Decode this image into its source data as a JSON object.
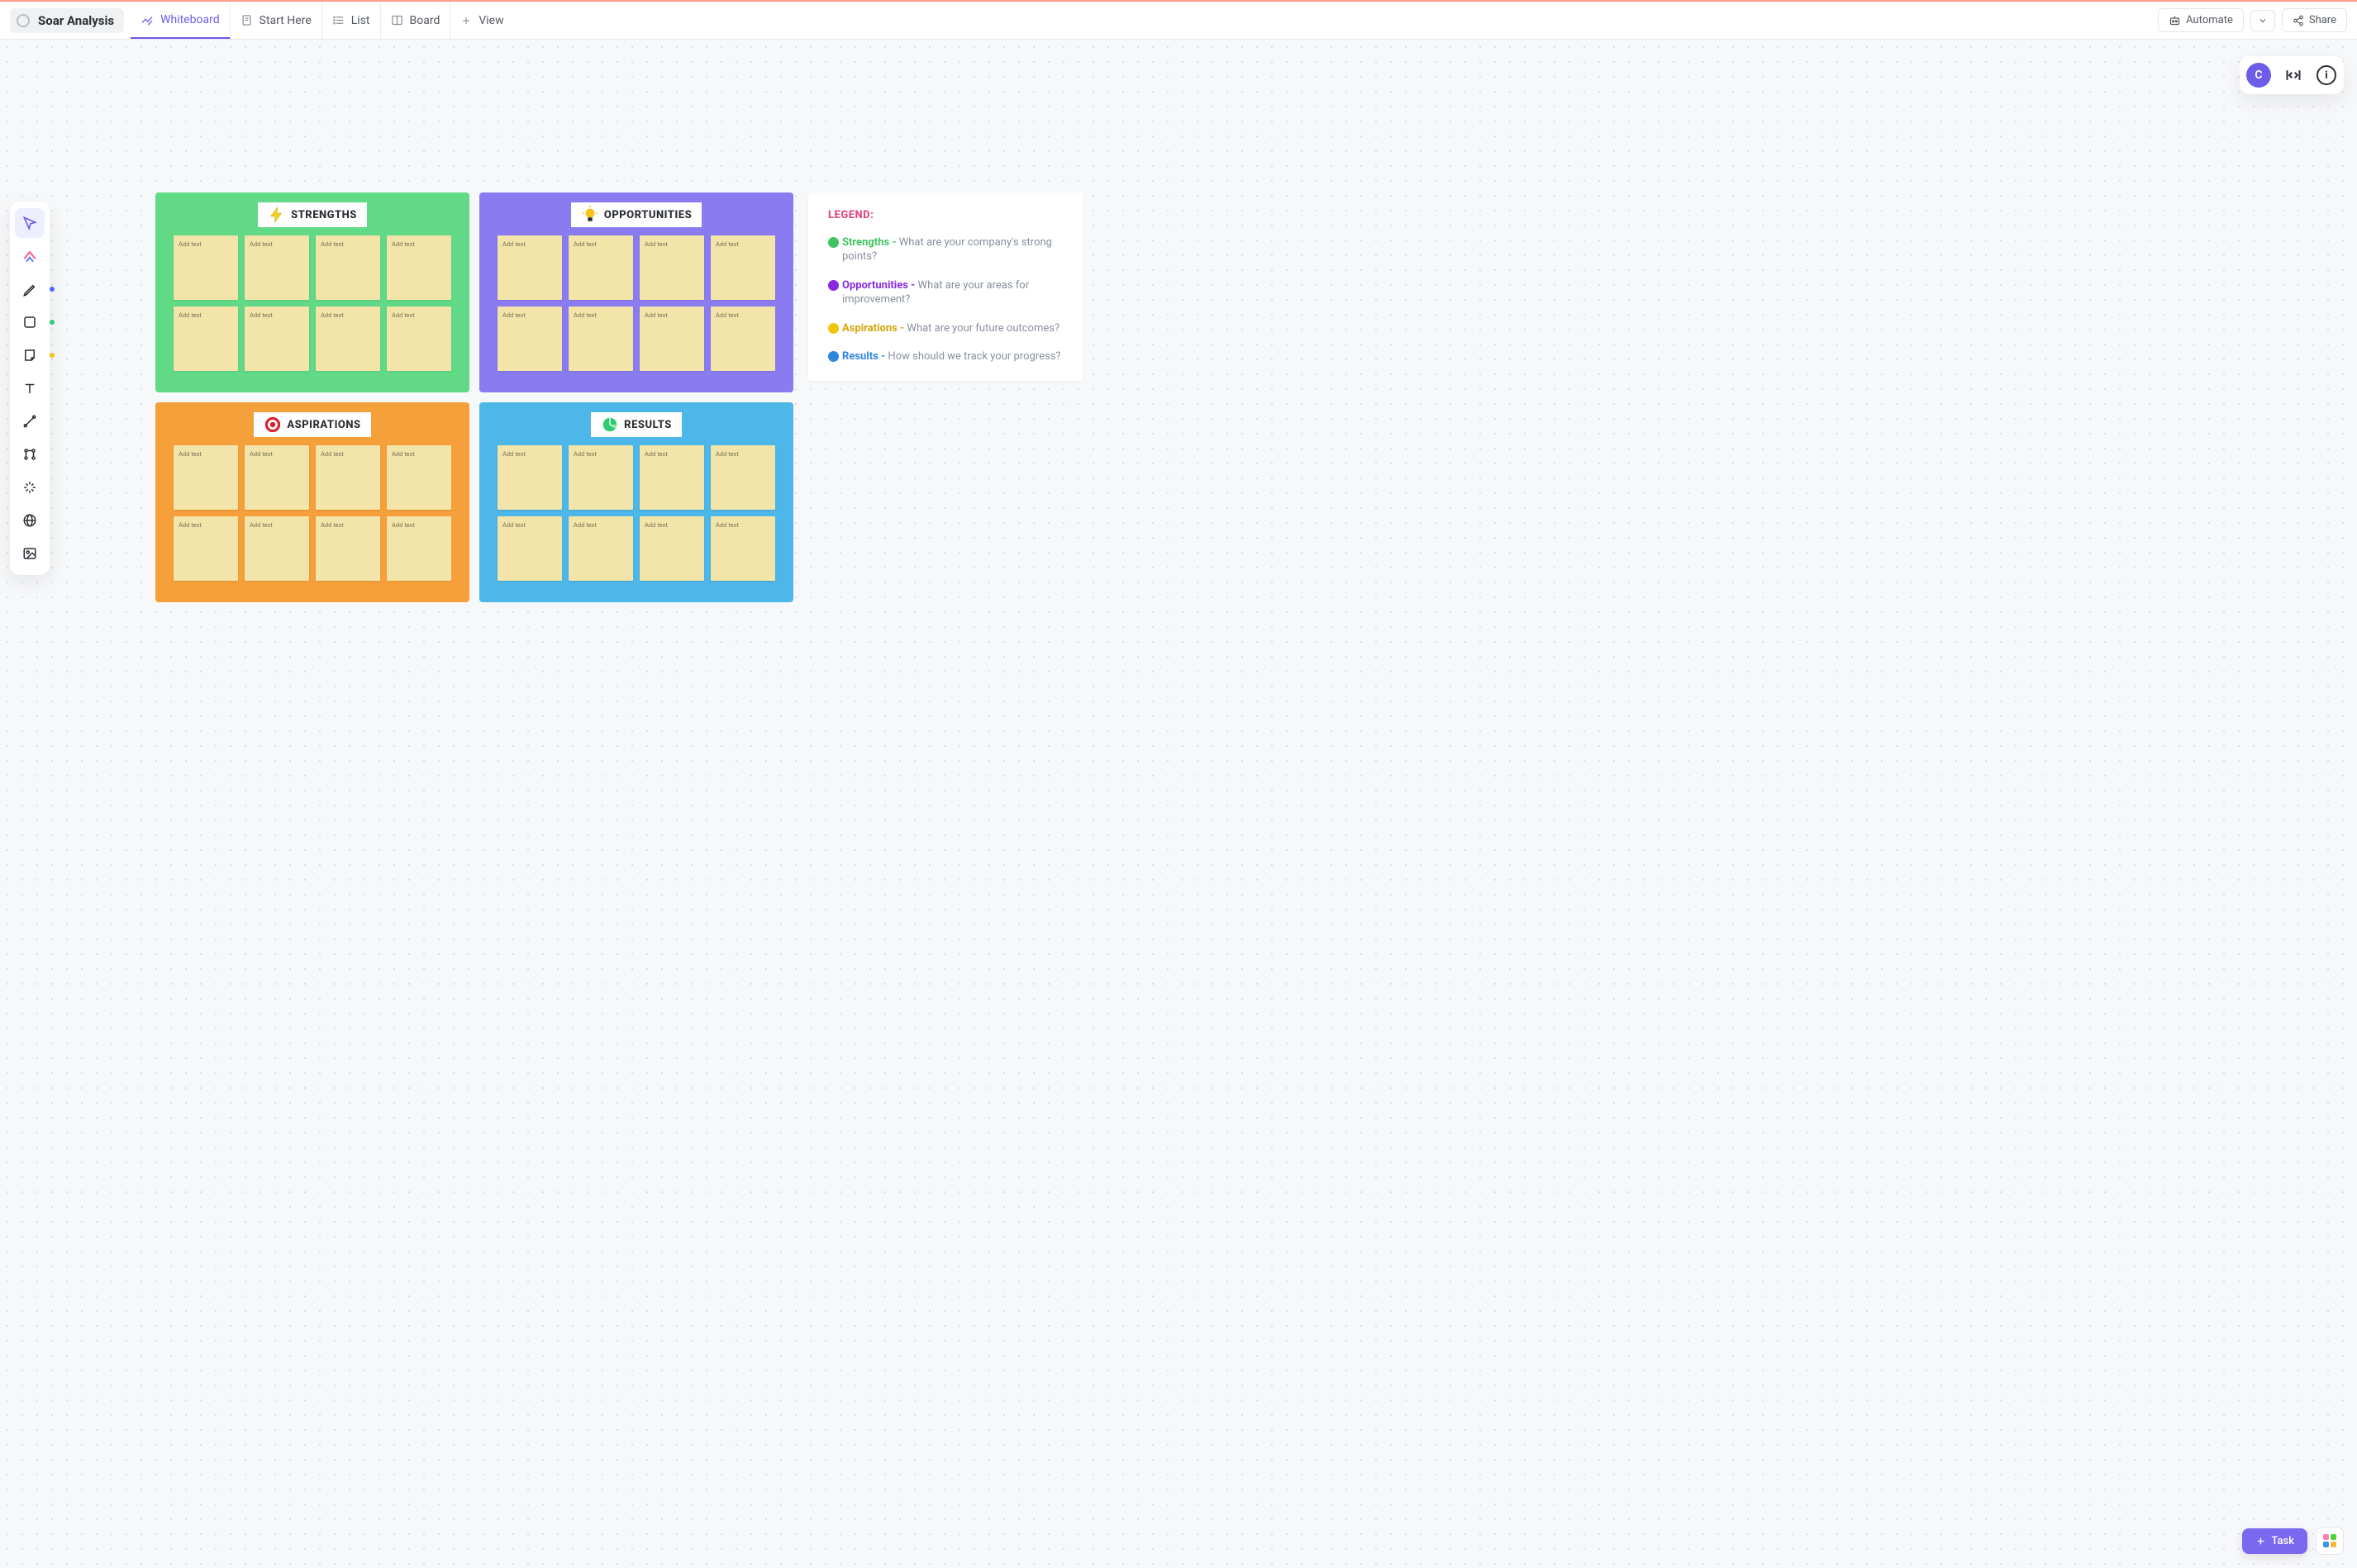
{
  "header": {
    "page_title": "Soar Analysis",
    "tabs": {
      "whiteboard": "Whiteboard",
      "start_here": "Start Here",
      "list": "List",
      "board": "Board",
      "add_view": "View"
    },
    "automate": "Automate",
    "share": "Share",
    "avatar_letter": "C"
  },
  "quadrants": {
    "strengths_label": "STRENGTHS",
    "opportunities_label": "OPPORTUNITIES",
    "aspirations_label": "ASPIRATIONS",
    "results_label": "RESULTS",
    "sticky_placeholder": "Add text"
  },
  "legend": {
    "title": "LEGEND:",
    "items": [
      {
        "color": "#40c463",
        "term_color": "#40c463",
        "term": "Strengths",
        "desc": "What are your company's strong points?"
      },
      {
        "color": "#8a2be2",
        "term_color": "#8a2be2",
        "term": "Opportunities",
        "desc": "What are your areas for improvement?"
      },
      {
        "color": "#f1c40f",
        "term_color": "#f1c40f",
        "term": "Aspirations",
        "desc": "What are your future outcomes?"
      },
      {
        "color": "#2e86de",
        "term_color": "#2e86de",
        "term": "Results",
        "desc": "How should we track your progress?"
      }
    ]
  },
  "fab": {
    "task_label": "Task"
  }
}
